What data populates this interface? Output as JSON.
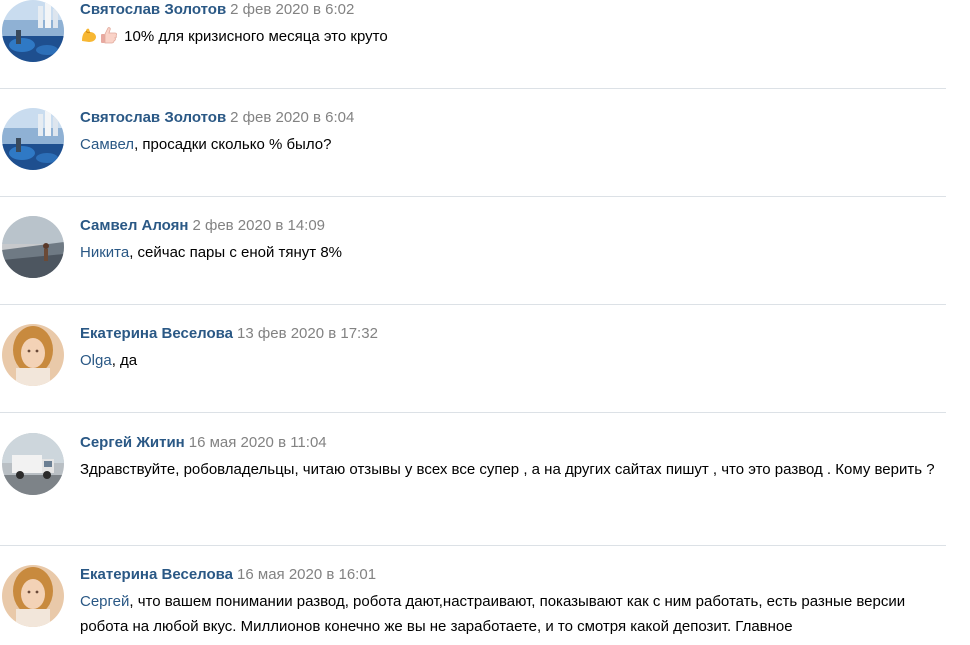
{
  "comments": [
    {
      "author": "Святослав Золотов",
      "date": "2 фев 2020 в 6:02",
      "emojis": [
        "flexed-biceps",
        "thumbs-up"
      ],
      "text": " 10% для кризисного месяца это круто"
    },
    {
      "author": "Святослав Золотов",
      "date": "2 фев 2020 в 6:04",
      "mention": "Самвел",
      "text": ", просадки сколько % было?"
    },
    {
      "author": "Самвел Алоян",
      "date": "2 фев 2020 в 14:09",
      "mention": "Никита",
      "text": ", сейчас пары с еной тянут 8%"
    },
    {
      "author": "Екатерина Веселова",
      "date": "13 фев 2020 в 17:32",
      "mention": "Olga",
      "text": ", да"
    },
    {
      "author": "Сергей Житин",
      "date": "16 мая 2020 в 11:04",
      "text": "Здравствуйте, робовладельцы, читаю отзывы у всех все супер , а на других сайтах пишут , что это развод . Кому верить ?"
    },
    {
      "author": "Екатерина Веселова",
      "date": "16 мая 2020 в 16:01",
      "mention": "Сергей",
      "text": ", что вашем понимании развод, робота дают,настраивают, показывают как с ним работать, есть разные версии робота на любой вкус. Миллионов конечно же вы не заработаете, и то смотря какой депозит. Главное"
    }
  ],
  "colors": {
    "author": "#2a5885",
    "date": "#828282",
    "divider": "#dce1e6"
  }
}
